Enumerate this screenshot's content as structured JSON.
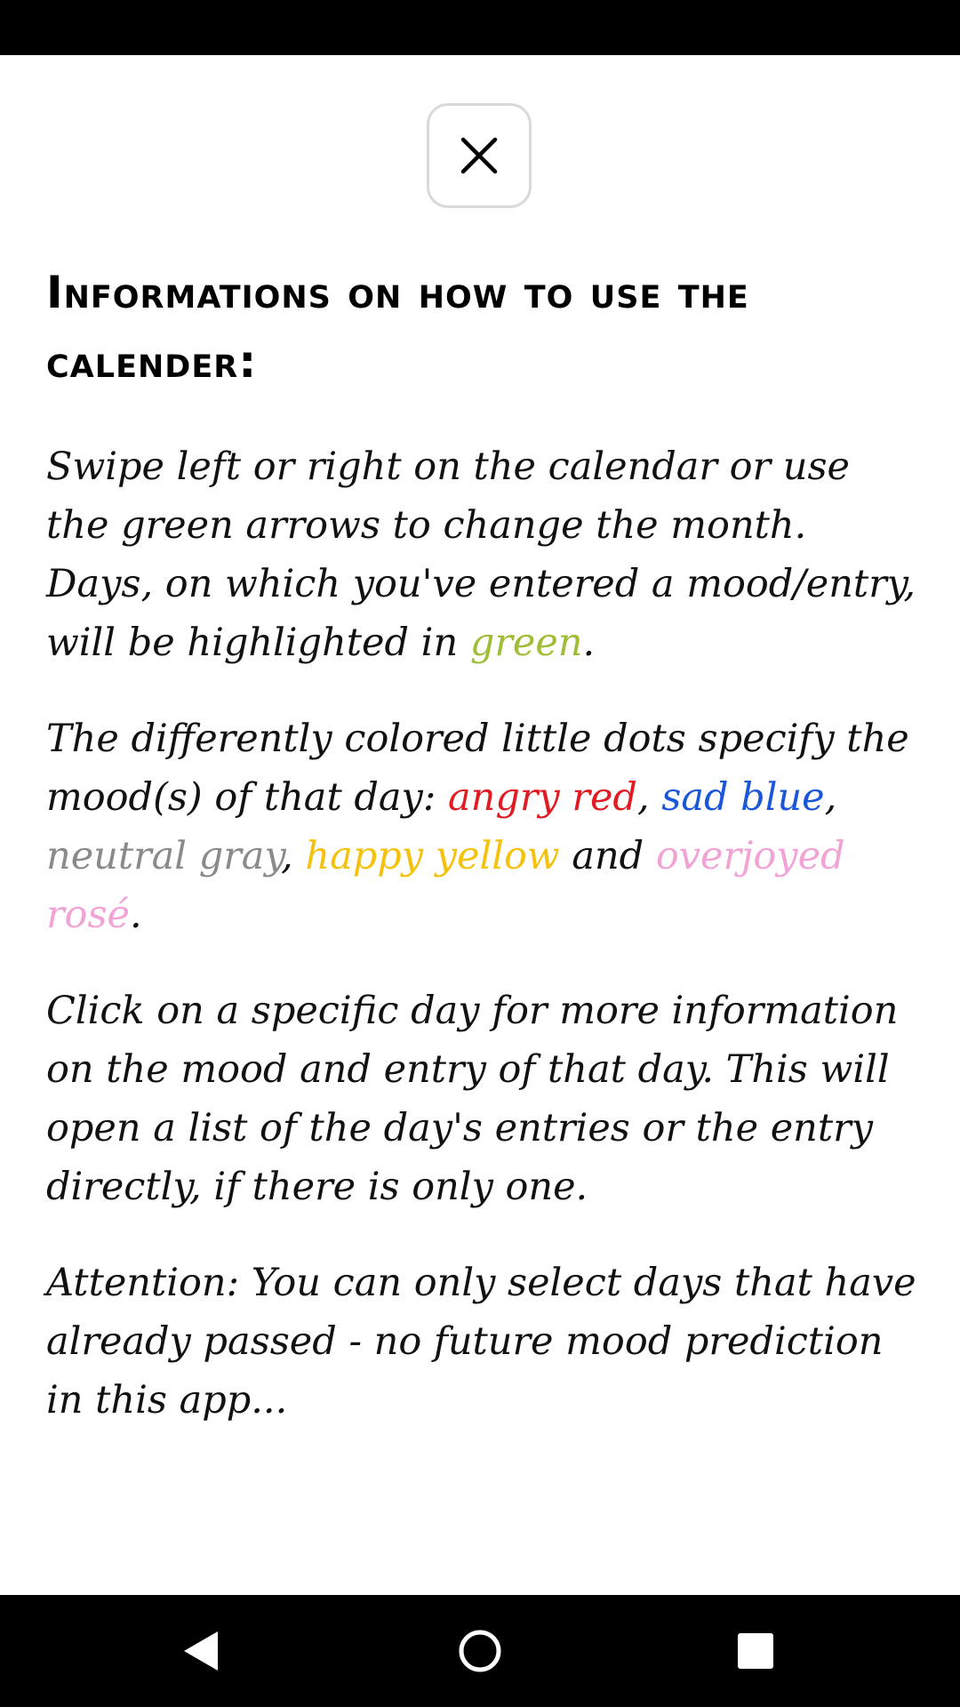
{
  "close_button": {
    "icon": "close-icon"
  },
  "heading": "Informations on how to use the calender:",
  "paragraph1": {
    "text_before": "Swipe left or right on the calendar or use the green arrows to change the month. Days, on which you've entered a mood/entry, will be highlighted in ",
    "green_word": "green",
    "text_after": "."
  },
  "paragraph2": {
    "intro": "The differently colored little dots specify the mood(s) of that day:  ",
    "angry": "angry red",
    "sep1": ", ",
    "sad": "sad blue",
    "sep2": ", ",
    "neutral": "neutral gray",
    "sep3": ", ",
    "happy": "happy yellow",
    "sep4": " and ",
    "overjoyed": "overjoyed rosé",
    "end": "."
  },
  "paragraph3": "Click on a specific day for more information on the mood and entry of that day. This will open a list of the day's entries or the entry directly, if there is only one.",
  "paragraph4": "Attention: You can only select days that have already passed - no future mood prediction in this app...",
  "colors": {
    "green": "#9fbd36",
    "red": "#e11b22",
    "blue": "#1a56d8",
    "gray": "#8a8a8a",
    "yellow": "#f4c20d",
    "rose": "#f2a3d6"
  },
  "nav_bar": {
    "back": "back-icon",
    "home": "home-icon",
    "recents": "recents-icon"
  }
}
